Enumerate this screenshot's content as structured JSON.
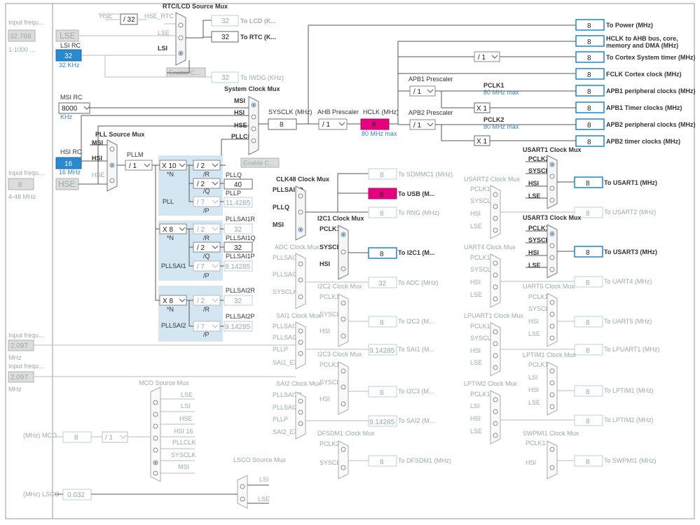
{
  "colors": {
    "accent": "#2a8ad0",
    "pink": "#e6007e",
    "pll_bg": "#d5e6f3"
  },
  "left": {
    "lse_freq": "32.768",
    "lse_range": "1-1000 ...",
    "lse_label": "LSE",
    "input_freq_top": "Input frequ...",
    "lsi_label": "LSI RC",
    "lsi_value": "32",
    "lsi_unit": "32 KHz",
    "msi_label": "MSI RC",
    "msi_value": "8000",
    "msi_unit": "KHz",
    "hsi_label": "HSI RC",
    "hsi_value": "16",
    "hsi_unit": "16 MHz",
    "hse_input_label": "Input frequ...",
    "hse_freq": "8",
    "hse_range": "4-48 MHz",
    "hse_label": "HSE",
    "in2_label": "Input frequ...",
    "in2_value": "2.097",
    "in2_unit": "MHz",
    "in3_label": "Input frequ...",
    "in3_value": "2.097",
    "in3_unit": "MHz",
    "mco_label": "(MHz) MCO",
    "mco_value": "8",
    "mco_div": "/ 1",
    "lsco_label": "(MHz) LSCO",
    "lsco_value": "0.032"
  },
  "rtc": {
    "title": "RTC/LCD Source Mux",
    "hse": "HSE",
    "div32": "/ 32",
    "hse_rtc": "HSE_RTC",
    "lse": "LSE",
    "lsi": "LSI",
    "enable": "Enable C...",
    "lcd_value": "32",
    "lcd_label": "To LCD (K...",
    "rtc_value": "32",
    "rtc_label": "To RTC (K...",
    "iwdg_value": "32",
    "iwdg_label": "To IWDG (KHz)"
  },
  "sysmux": {
    "title": "System Clock Mux",
    "msi": "MSI",
    "hsi": "HSI",
    "hse": "HSE",
    "pllclk": "PLLCLK",
    "enable": "Enable C...",
    "sysclk_label": "SYSCLK (MHz)",
    "sysclk_value": "8",
    "ahb_label": "AHB Prescaler",
    "ahb_value": "/ 1",
    "hclk_label": "HCLK (MHz)",
    "hclk_value": "8",
    "hclk_max": "80 MHz max"
  },
  "pll": {
    "src_title": "PLL Source Mux",
    "msi": "MSI",
    "hsi": "HSI",
    "hse": "HSE",
    "pllm_label": "PLLM",
    "pllm_value": "/ 1",
    "main_label": "PLL",
    "n_value": "X 10",
    "n_label": "*N",
    "r_value": "/ 2",
    "r_label": "/R",
    "q_value": "/ 2",
    "q_label": "/Q",
    "p_value": "/ 7",
    "p_label": "/P",
    "pllq_label": "PLLQ",
    "pllq_value": "40",
    "pllp_label": "PLLP",
    "pllp_value": "11.4285",
    "sai1_label": "PLLSAI1",
    "sai1_n": "X 8",
    "sai1_r": "/ 2",
    "sai1_q": "/ 2",
    "sai1_p": "/ 7",
    "sai1r_label": "PLLSAI1R",
    "sai1r_value": "32",
    "sai1q_label": "PLLSAI1Q",
    "sai1q_value": "32",
    "sai1p_label": "PLLSAI1P",
    "sai1p_value": "9.14285",
    "sai2_label": "PLLSAI2",
    "sai2_n": "X 8",
    "sai2_r": "/ 2",
    "sai2_p": "/ 7",
    "sai2r_label": "PLLSAI2R",
    "sai2r_value": "32",
    "sai2p_label": "PLLSAI2P",
    "sai2p_value": "9.14285"
  },
  "outputs": {
    "power_value": "8",
    "power_label": "To Power (MHz)",
    "ahb_value": "8",
    "ahb_label": "HCLK to AHB bus, core,",
    "ahb_label2": "memory and DMA (MHz)",
    "systick_div": "/ 1",
    "systick_value": "8",
    "systick_label": "To Cortex System timer (MHz)",
    "fclk_value": "8",
    "fclk_label": "FCLK Cortex clock (MHz)",
    "apb1_pres_label": "APB1 Prescaler",
    "apb1_pres": "/ 1",
    "pclk1_label": "PCLK1",
    "pclk1_max": "80 MHz max",
    "apb1_periph_value": "8",
    "apb1_periph_label": "APB1 peripheral clocks (MHz)",
    "apb1_x": "X 1",
    "apb1_timer_value": "8",
    "apb1_timer_label": "APB1 Timer clocks (MHz)",
    "apb2_pres_label": "APB2 Prescaler",
    "apb2_pres": "/ 1",
    "pclk2_label": "PCLK2",
    "pclk2_max": "80 MHz max",
    "apb2_periph_value": "8",
    "apb2_periph_label": "APB2 peripheral clocks (MHz)",
    "apb2_x": "X 1",
    "apb2_timer_value": "8",
    "apb2_timer_label": "APB2 timer clocks (MHz)"
  },
  "clk48": {
    "title": "CLK48 Clock Mux",
    "in1": "PLLSAI1Q",
    "in2": "PLLQ",
    "in3": "MSI",
    "sdmmc_value": "8",
    "sdmmc_label": "To SDMMC1 (MHz)",
    "usb_value": "8",
    "usb_label": "To USB (M...",
    "rng_value": "8",
    "rng_label": "To RNG (MHz)"
  },
  "mid": {
    "i2c1_title": "I2C1 Clock Mux",
    "i2c1_in": [
      "PCLK1",
      "SYSCLK",
      "HSI"
    ],
    "i2c1_value": "8",
    "i2c1_label": "To I2C1 (M...",
    "adc_title": "ADC Clock Mux",
    "adc_in": [
      "PLLSAI1R",
      "PLLSAI2R",
      "SYSCLK"
    ],
    "adc_value": "32",
    "adc_label": "To ADC (MHz)",
    "i2c2_title": "I2C2 Clock Mux",
    "i2c2_in": [
      "PCLK1",
      "SYSCLK",
      "HSI"
    ],
    "i2c2_value": "8",
    "i2c2_label": "To I2C2 (M...",
    "sai1_title": "SAI1 Clock Mux",
    "sai1_in": [
      "PLLSAI1P",
      "PLLSAI2P",
      "PLLP",
      "SAI1_EXT"
    ],
    "sai1_value": "9.14285",
    "sai1_label": "To SAI1 (M...",
    "i2c3_title": "I2C3 Clock Mux",
    "i2c3_in": [
      "PCLK1",
      "SYSCLK",
      "HSI"
    ],
    "i2c3_value": "8",
    "i2c3_label": "To I2C3 (M...",
    "sai2_title": "SAI2 Clock Mux",
    "sai2_in": [
      "PLLSAI1P",
      "PLLSAI2P",
      "PLLP",
      "SAI2_EXT"
    ],
    "sai2_value": "9.14285",
    "sai2_label": "To SAI2 (M...",
    "dfsdm_title": "DFSDM1 Clock Mux",
    "dfsdm_in": [
      "PCLK2",
      "SYSCLK"
    ],
    "dfsdm_value": "8",
    "dfsdm_label": "To DFSDM1 (MHz)"
  },
  "mco": {
    "title": "MCO Source Mux",
    "in": [
      "LSE",
      "LSI",
      "HSE",
      "HSI 16",
      "PLLCLK",
      "SYSCLK",
      "MSI"
    ]
  },
  "lsco": {
    "title": "LSCO Source Mux",
    "in": [
      "LSI",
      "LSE"
    ]
  },
  "right": {
    "usart1_title": "USART1 Clock Mux",
    "usart1_in": [
      "PCLK2",
      "SYSCLK",
      "HSI",
      "LSE"
    ],
    "usart1_value": "8",
    "usart1_label": "To USART1 (MHz)",
    "usart2_title": "USART2 Clock Mux",
    "usart2_in": [
      "PCLK1",
      "SYSCLK",
      "HSI",
      "LSE"
    ],
    "usart2_value": "8",
    "usart2_label": "To USART2 (MHz)",
    "usart3_title": "USART3 Clock Mux",
    "usart3_in": [
      "PCLK1",
      "SYSCLK",
      "HSI",
      "LSE"
    ],
    "usart3_value": "8",
    "usart3_label": "To USART3 (MHz)",
    "uart4_title": "UART4 Clock Mux",
    "uart4_in": [
      "PCLK1",
      "SYSCLK",
      "HSI",
      "LSE"
    ],
    "uart4_value": "8",
    "uart4_label": "To UART4 (MHz)",
    "uart5_title": "UART5 Clock Mux",
    "uart5_in": [
      "PCLK1",
      "SYSCLK",
      "HSI",
      "LSE"
    ],
    "uart5_value": "8",
    "uart5_label": "To UART5 (MHz)",
    "lpuart1_title": "LPUART1 Clock Mux",
    "lpuart1_in": [
      "PCLK1",
      "SYSCLK",
      "HSI",
      "LSE"
    ],
    "lpuart1_value": "8",
    "lpuart1_label": "To LPUART1 (MHz)",
    "lptim1_title": "LPTIM1 Clock Mux",
    "lptim1_in": [
      "PCLK1",
      "LSI",
      "HSI",
      "LSE"
    ],
    "lptim1_value": "8",
    "lptim1_label": "To LPTIM1 (MHz)",
    "lptim2_title": "LPTIM2 Clock Mux",
    "lptim2_in": [
      "PCLK1",
      "LSI",
      "HSI",
      "LSE"
    ],
    "lptim2_value": "8",
    "lptim2_label": "To LPTIM2 (MHz)",
    "swpmi_title": "SWPMI1 Clock Mux",
    "swpmi_in": [
      "PCLK1",
      "HSI"
    ],
    "swpmi_value": "8",
    "swpmi_label": "To SWPMI1 (MHz)"
  }
}
